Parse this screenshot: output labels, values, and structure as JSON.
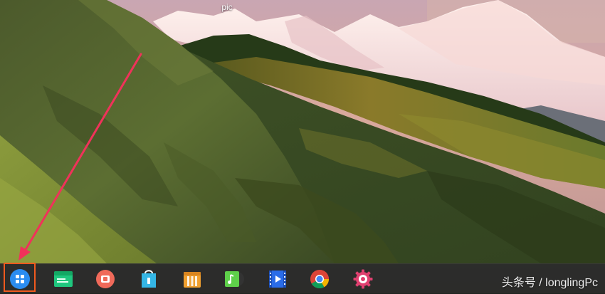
{
  "desktop": {
    "icon_label": "pic"
  },
  "taskbar": {
    "items": [
      {
        "name": "launcher",
        "icon": "launcher-grid-icon"
      },
      {
        "name": "file-manager",
        "icon": "file-manager-icon"
      },
      {
        "name": "screen-recorder",
        "icon": "screen-recorder-icon"
      },
      {
        "name": "app-store",
        "icon": "app-store-icon"
      },
      {
        "name": "archive-manager",
        "icon": "archive-manager-icon"
      },
      {
        "name": "music-player",
        "icon": "music-player-icon"
      },
      {
        "name": "video-player",
        "icon": "video-player-icon"
      },
      {
        "name": "chrome",
        "icon": "chrome-icon"
      },
      {
        "name": "settings",
        "icon": "settings-gear-icon"
      }
    ]
  },
  "watermark": {
    "text": "头条号 / longlingPc"
  },
  "colors": {
    "highlight": "#f05a1e",
    "arrow": "#f0325a",
    "launcher": "#2a8cf0"
  }
}
